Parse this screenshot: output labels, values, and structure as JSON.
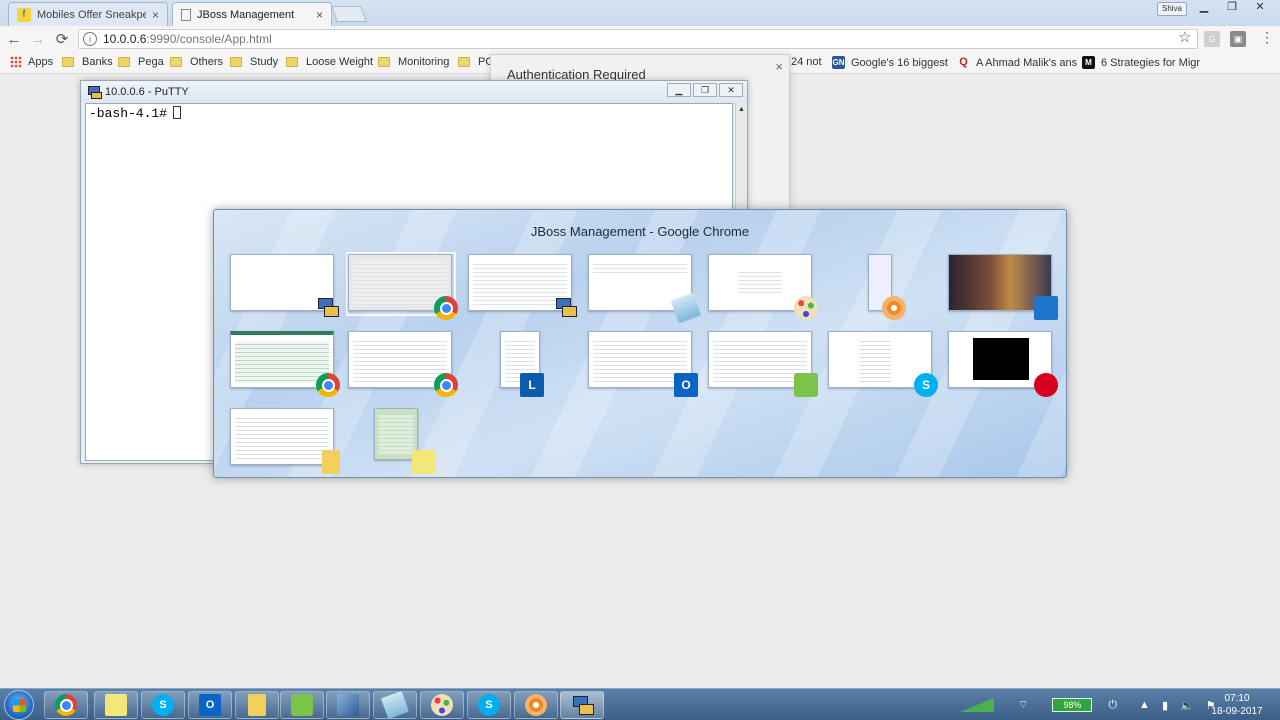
{
  "browser": {
    "tabs": [
      {
        "title": "Mobiles Offer Sneakpeak",
        "icon": "flipkart-icon",
        "active": false
      },
      {
        "title": "JBoss Management",
        "icon": "page-icon",
        "active": true
      }
    ],
    "user_badge": "Shiva",
    "address": {
      "host": "10.0.0.6",
      "path": ":9990/console/App.html"
    },
    "bookmarks": [
      {
        "label": "Apps",
        "type": "apps"
      },
      {
        "label": "Banks",
        "type": "folder"
      },
      {
        "label": "Pega",
        "type": "folder"
      },
      {
        "label": "Others",
        "type": "folder"
      },
      {
        "label": "Study",
        "type": "folder"
      },
      {
        "label": "Loose Weight",
        "type": "folder"
      },
      {
        "label": "Monitoring",
        "type": "folder"
      },
      {
        "label": "PCF",
        "type": "folder"
      },
      {
        "label": "24 not",
        "type": "site"
      },
      {
        "label": "Google's 16 biggest",
        "type": "site",
        "icon": "GN"
      },
      {
        "label": "A Ahmad Malik's ans",
        "type": "site",
        "icon": "Q"
      },
      {
        "label": "6 Strategies for Migr",
        "type": "site",
        "icon": "M"
      }
    ]
  },
  "auth_dialog": {
    "title": "Authentication Required"
  },
  "putty": {
    "title": "10.0.0.6 - PuTTY",
    "prompt": "-bash-4.1#"
  },
  "switcher": {
    "title": "JBoss Management - Google Chrome",
    "windows": [
      {
        "app": "putty",
        "icon": "putty-icon"
      },
      {
        "app": "chrome",
        "icon": "chrome-icon",
        "selected": true
      },
      {
        "app": "putty",
        "icon": "putty-icon"
      },
      {
        "app": "notepad",
        "icon": "notepad-icon"
      },
      {
        "app": "paint",
        "icon": "paint-icon"
      },
      {
        "app": "flower-app",
        "icon": "flower-icon"
      },
      {
        "app": "desktop",
        "icon": "desktop-icon"
      },
      {
        "app": "chrome",
        "icon": "chrome-icon"
      },
      {
        "app": "chrome",
        "icon": "chrome-icon"
      },
      {
        "app": "lync",
        "icon": "lync-icon",
        "glyph": "L"
      },
      {
        "app": "outlook",
        "icon": "outlook-icon",
        "glyph": "O"
      },
      {
        "app": "notepadpp",
        "icon": "notepadpp-icon"
      },
      {
        "app": "skype",
        "icon": "skype-icon",
        "glyph": "S"
      },
      {
        "app": "redhat",
        "icon": "redhat-icon"
      },
      {
        "app": "explorer",
        "icon": "folder-icon"
      },
      {
        "app": "sticky-notes",
        "icon": "sticky-notes-icon"
      }
    ]
  },
  "taskbar": {
    "apps": [
      "chrome-icon",
      "sticky-notes-icon",
      "skype-icon",
      "outlook-icon",
      "explorer-icon",
      "notepadpp-icon",
      "virtualbox-icon",
      "notepad-icon",
      "paint-icon",
      "skype-icon",
      "flower-icon",
      "putty-icon"
    ],
    "battery": "98%",
    "time": "07:10",
    "date": "18-09-2017"
  },
  "colors": {
    "accent": "#3b5f87",
    "switcher": "#b8d1ee"
  }
}
